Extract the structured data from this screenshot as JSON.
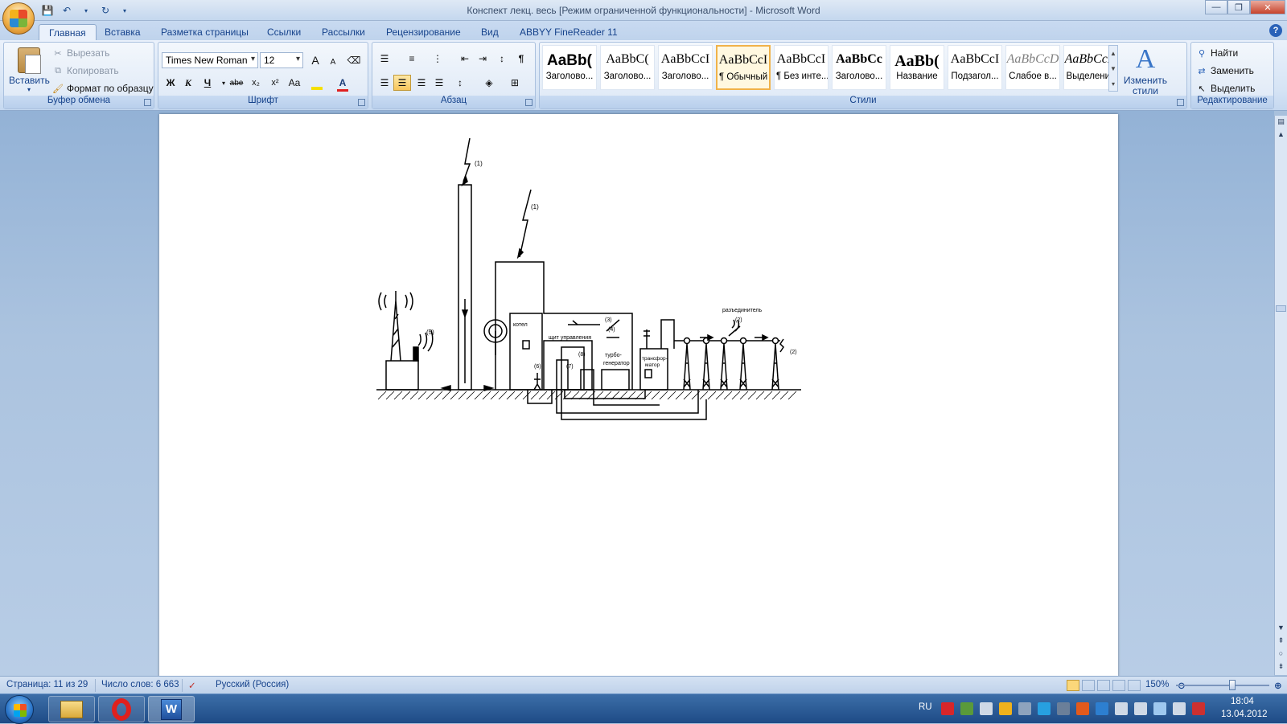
{
  "window": {
    "title": "Конспект лекц. весь [Режим ограниченной функциональности] - Microsoft Word",
    "controls": {
      "minimize": "—",
      "maximize": "❐",
      "close": "✕"
    }
  },
  "tabs": [
    {
      "label": "Главная",
      "active": true
    },
    {
      "label": "Вставка"
    },
    {
      "label": "Разметка страницы"
    },
    {
      "label": "Ссылки"
    },
    {
      "label": "Рассылки"
    },
    {
      "label": "Рецензирование"
    },
    {
      "label": "Вид"
    },
    {
      "label": "ABBYY FineReader 11"
    }
  ],
  "clipboard": {
    "group_label": "Буфер обмена",
    "paste": "Вставить",
    "cut": "Вырезать",
    "copy": "Копировать",
    "format_painter": "Формат по образцу"
  },
  "font": {
    "group_label": "Шрифт",
    "family": "Times New Roman",
    "size": "12",
    "grow": "A",
    "shrink": "A",
    "bold": "Ж",
    "italic": "К",
    "underline": "Ч",
    "strike": "abe",
    "subscript": "x₂",
    "superscript": "x²",
    "case": "Aa",
    "highlight_color": "#f5e000",
    "font_color": "#e02020"
  },
  "paragraph": {
    "group_label": "Абзац"
  },
  "styles": {
    "group_label": "Стили",
    "items": [
      {
        "sample": "AaBb(",
        "name": "Заголово..."
      },
      {
        "sample": "AaBbC(",
        "name": "Заголово..."
      },
      {
        "sample": "AaBbCcI",
        "name": "Заголово..."
      },
      {
        "sample": "AaBbCcI",
        "name": "¶ Обычный",
        "selected": true
      },
      {
        "sample": "AaBbCcI",
        "name": "¶ Без инте..."
      },
      {
        "sample": "AaBbCc",
        "name": "Заголово..."
      },
      {
        "sample": "AaBb(",
        "name": "Название"
      },
      {
        "sample": "AaBbCcI",
        "name": "Подзагол..."
      },
      {
        "sample": "AaBbCcD",
        "name": "Слабое в..."
      },
      {
        "sample": "AaBbCcD",
        "name": "Выделение"
      }
    ],
    "change_styles": "Изменить стили"
  },
  "editing": {
    "group_label": "Редактирование",
    "find": "Найти",
    "replace": "Заменить",
    "select": "Выделить"
  },
  "diagram": {
    "labels": {
      "lightning1": "(1)",
      "lightning2": "(1)",
      "antenna": "(5)",
      "boiler": "котел",
      "control_panel": "щит управления",
      "n3": "(3)",
      "n4": "(4)",
      "n6": "(6)",
      "n7": "(7)",
      "n8": "(8)",
      "turbo": "турбо-",
      "generator": "генератор",
      "transformer1": "трансфор-",
      "transformer2": "матор",
      "disconnector": "разъединитель",
      "n2a": "(2)",
      "n2b": "(2)"
    }
  },
  "statusbar": {
    "page": "Страница: 11 из 29",
    "words": "Число слов: 6 663",
    "language": "Русский (Россия)",
    "zoom": "150%",
    "zoom_level_percent": 150
  },
  "taskbar": {
    "lang": "RU",
    "time": "18:04",
    "date": "13.04.2012"
  }
}
